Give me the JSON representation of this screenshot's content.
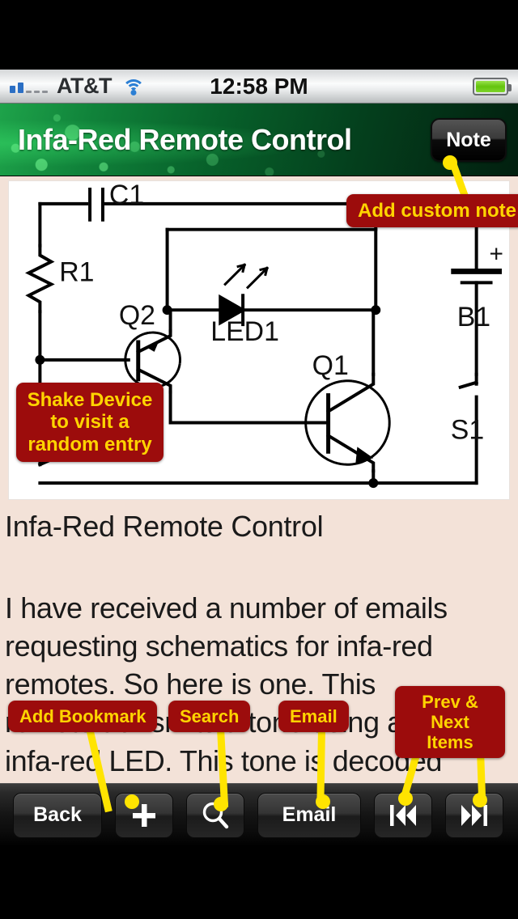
{
  "statusbar": {
    "carrier": "AT&T",
    "time": "12:58 PM",
    "signal_bars_filled": 2,
    "signal_bars_empty": 3,
    "wifi": "wifi-icon",
    "battery": "battery-full-icon"
  },
  "header": {
    "title": "Infa-Red Remote Control",
    "note_button": "Note"
  },
  "schematic": {
    "labels": {
      "c1": "C1",
      "r1": "R1",
      "q2": "Q2",
      "led1": "LED1",
      "q1": "Q1",
      "b1": "B1",
      "s1": "S1",
      "plus": "+"
    }
  },
  "article": {
    "title": "Infa-Red Remote Control",
    "body_lines": [
      "I have received a number of emails",
      "requesting schematics for infa-red",
      "remotes. So here is one. This",
      "remote transmits a tone using an",
      "infa-red LED. This tone is decoded"
    ]
  },
  "tooltips": {
    "add_custom_note": "Add custom note",
    "shake_device_line1": "Shake Device",
    "shake_device_line2": "to visit a",
    "shake_device_line3": "random entry",
    "add_bookmark": "Add Bookmark",
    "search": "Search",
    "email": "Email",
    "prev_next_line1": "Prev & Next",
    "prev_next_line2": "Items"
  },
  "toolbar": {
    "back": "Back",
    "add": "plus-icon",
    "search": "search-icon",
    "email": "Email",
    "prev": "skip-backward-icon",
    "next": "skip-forward-icon"
  },
  "colors": {
    "tooltip_bg": "#9c0c0c",
    "tooltip_text": "#ffd400",
    "pointer": "#ffe400",
    "header_green": "#10823a",
    "paper": "#f3e2d8"
  }
}
